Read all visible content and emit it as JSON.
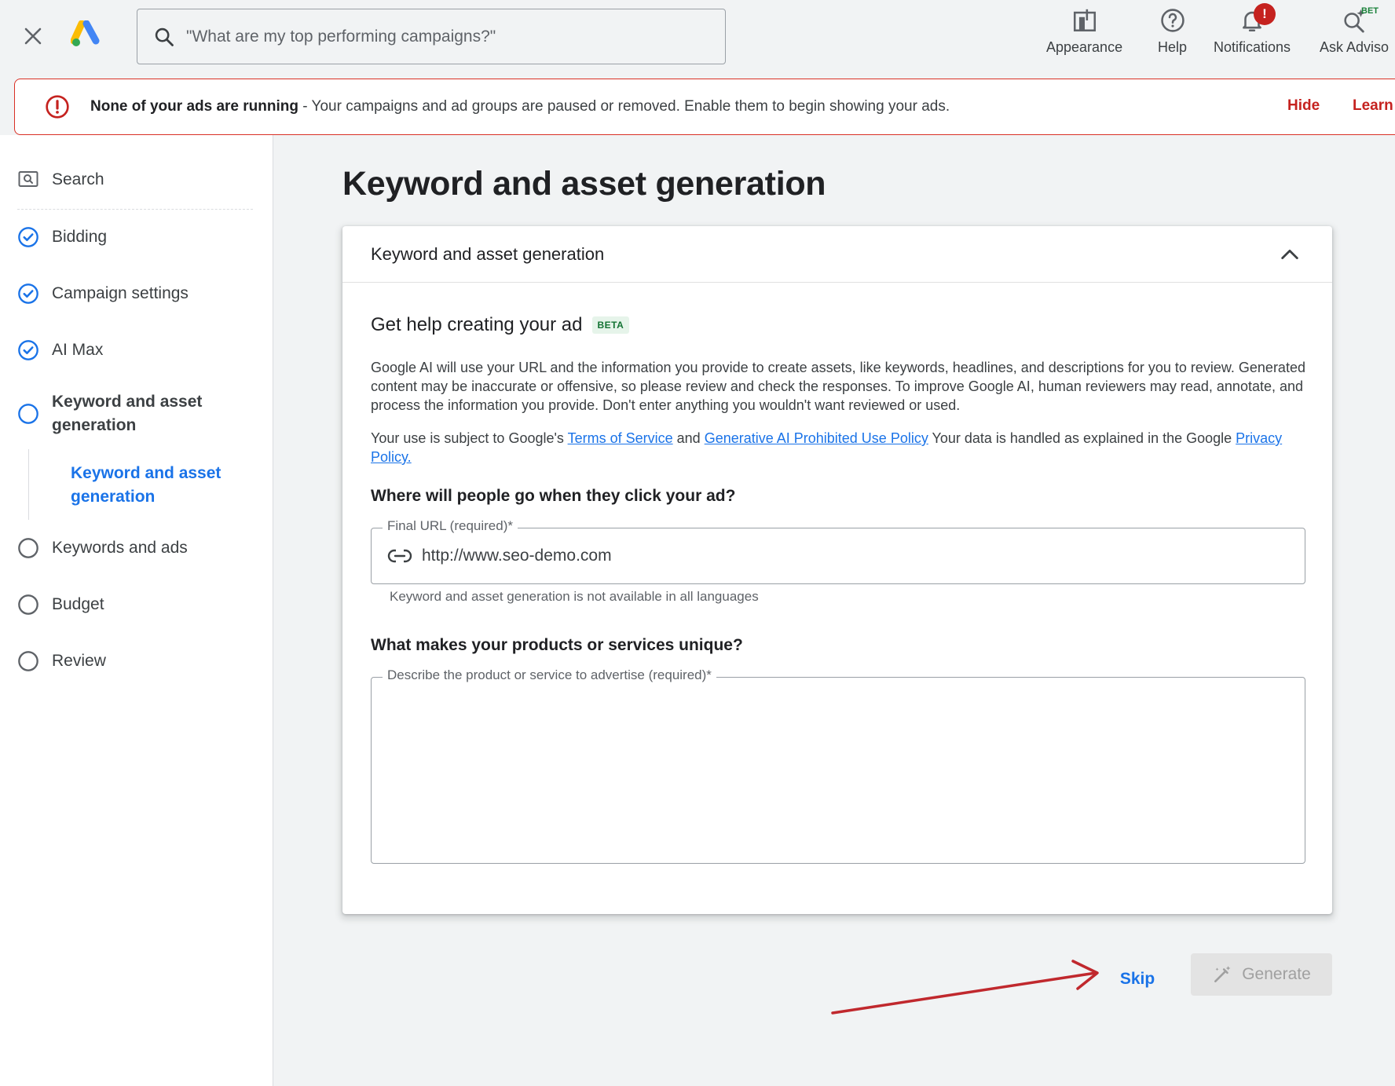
{
  "topbar": {
    "search_placeholder": "\"What are my top performing campaigns?\"",
    "actions": [
      {
        "label": "Appearance",
        "icon": "appearance-icon"
      },
      {
        "label": "Help",
        "icon": "help-icon"
      },
      {
        "label": "Notifications",
        "icon": "bell-icon",
        "badge": "!"
      },
      {
        "label": "Ask Adviso",
        "icon": "ask-advisor-icon",
        "corner_badge": "BET"
      }
    ]
  },
  "alert": {
    "bold": "None of your ads are running",
    "text": " - Your campaigns and ad groups are paused or removed. Enable them to begin showing your ads.",
    "hide": "Hide",
    "learn": "Learn",
    "color": "#d93025"
  },
  "sidebar": {
    "items": [
      {
        "label": "Search",
        "state": "type"
      },
      {
        "label": "Bidding",
        "state": "done"
      },
      {
        "label": "Campaign settings",
        "state": "done"
      },
      {
        "label": "AI Max",
        "state": "done"
      },
      {
        "label": "Keyword and asset generation",
        "state": "active"
      },
      {
        "label": "Keywords and ads",
        "state": "todo"
      },
      {
        "label": "Budget",
        "state": "todo"
      },
      {
        "label": "Review",
        "state": "todo"
      }
    ],
    "sub_item": "Keyword and asset generation"
  },
  "main": {
    "title": "Keyword and asset generation",
    "card": {
      "header": "Keyword and asset generation",
      "subtitle": "Get help creating your ad",
      "beta": "BETA",
      "paragraph1": "Google AI will use your URL and the information you provide to create assets, like keywords, headlines, and descriptions for you to review. Generated content may be inaccurate or offensive, so please review and check the responses. To improve Google AI, human reviewers may read, annotate, and process the information you provide. Don't enter anything you wouldn't want reviewed or used.",
      "p2_prefix": "Your use is subject to Google's ",
      "p2_tos": "Terms of Service",
      "p2_and": " and ",
      "p2_policy": "Generative AI Prohibited Use Policy",
      "p2_mid": " Your data is handled as explained in the Google ",
      "p2_privacy": "Privacy Policy.",
      "q1": "Where will people go when they click your ad?",
      "url_label": "Final URL (required)*",
      "url_value": "http://www.seo-demo.com",
      "url_hint": "Keyword and asset generation is not available in all languages",
      "q2": "What makes your products or services unique?",
      "desc_label": "Describe the product or service to advertise (required)*",
      "desc_value": ""
    },
    "skip": "Skip",
    "generate": "Generate"
  },
  "colors": {
    "accent": "#1a73e8",
    "error": "#c5221f",
    "annotation_arrow": "#c0282d"
  }
}
